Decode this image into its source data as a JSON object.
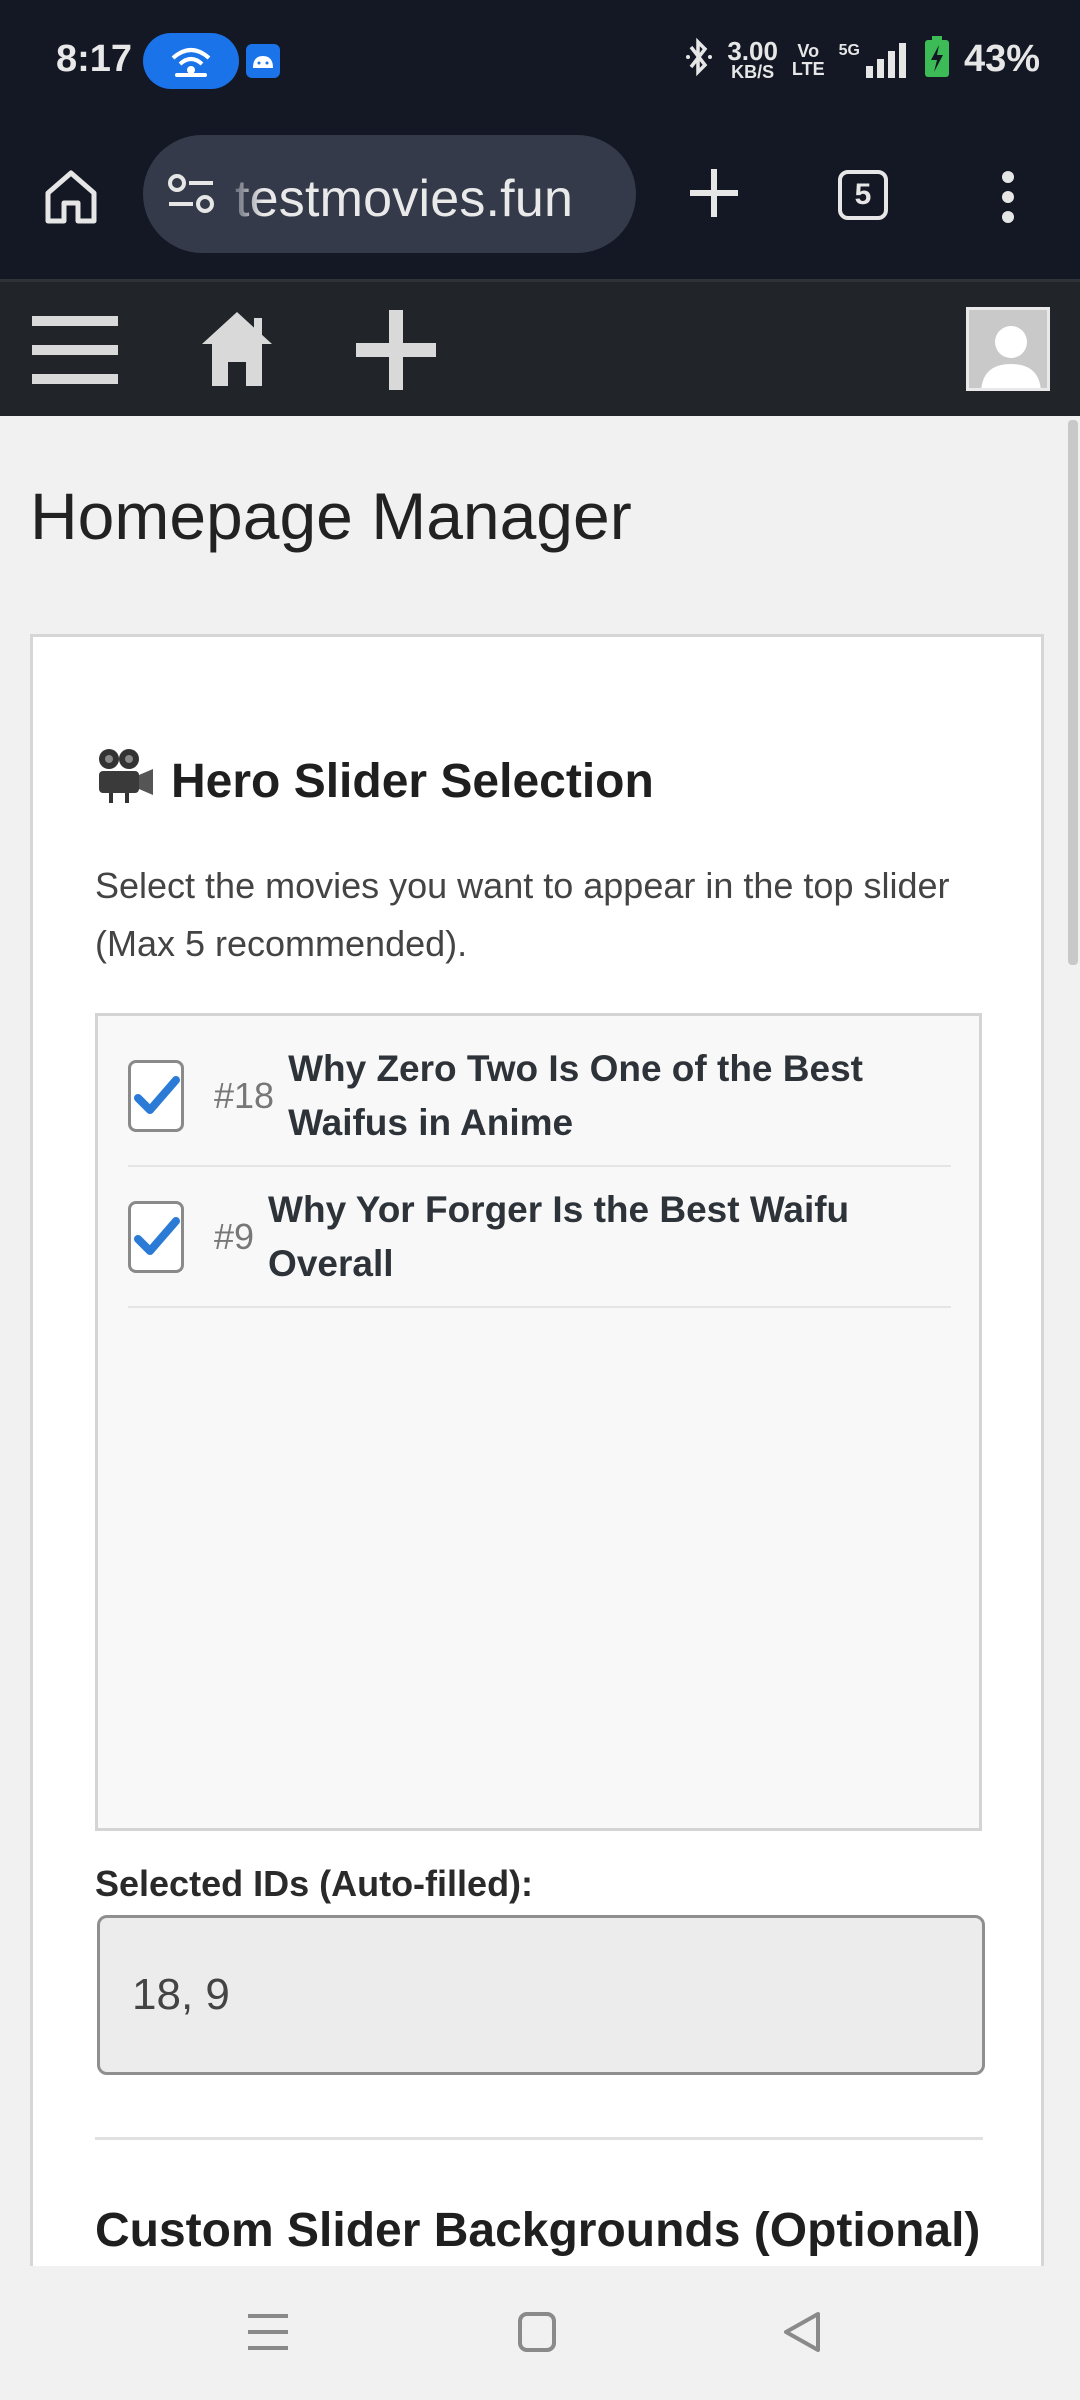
{
  "status_bar": {
    "time": "8:17",
    "net_speed_value": "3.00",
    "net_speed_unit": "KB/S",
    "volte_top": "Vo",
    "volte_bottom": "LTE",
    "signal_label": "5G",
    "battery": "43%",
    "icons": [
      "hotspot-icon",
      "android-icon",
      "bluetooth-icon",
      "signal-icon",
      "battery-charging-icon"
    ]
  },
  "browser": {
    "url": "testmovies.fun",
    "tab_count": "5"
  },
  "site_nav": {
    "icons": [
      "menu-icon",
      "home-icon",
      "plus-icon",
      "avatar"
    ]
  },
  "page": {
    "title": "Homepage Manager"
  },
  "hero_slider": {
    "heading_emoji": "🎥",
    "heading": "Hero Slider Selection",
    "description": "Select the movies you want to appear in the top slider (Max 5 recommended).",
    "items": [
      {
        "id": "#18",
        "title": "Why Zero Two Is One of the Best Waifus in Anime",
        "checked": true
      },
      {
        "id": "#9",
        "title": "Why Yor Forger Is the Best Waifu Overall",
        "checked": true
      }
    ],
    "selected_label": "Selected IDs (Auto-filled):",
    "selected_value": "18, 9"
  },
  "custom_backgrounds": {
    "heading": "Custom Slider Backgrounds (Optional)"
  },
  "colors": {
    "status_bg": "#131824",
    "nav_bg": "#212529",
    "accent": "#1a73e8",
    "check": "#2b7bd6"
  }
}
